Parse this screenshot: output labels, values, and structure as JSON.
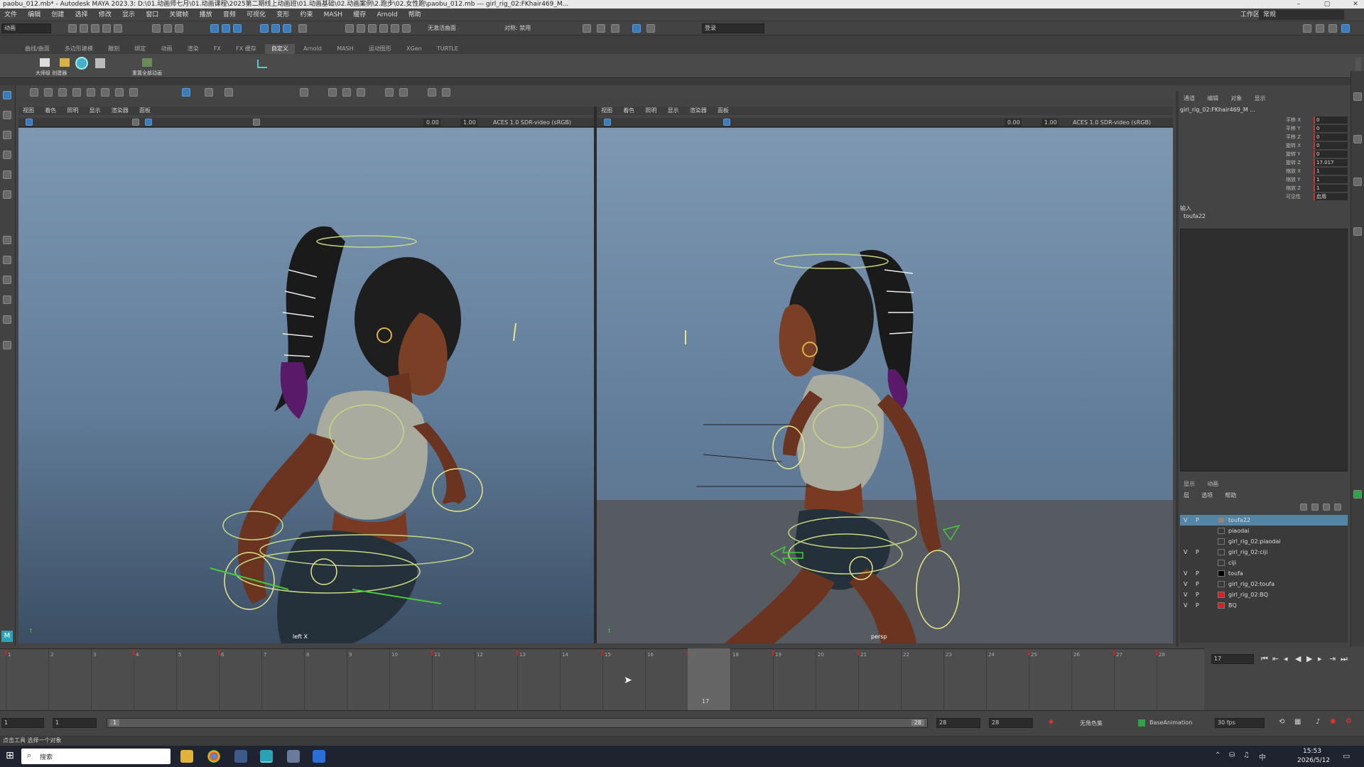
{
  "titlebar": {
    "text": "paobu_012.mb* - Autodesk MAYA 2023.3: D:\\01.动画师七月\\01.动画课程\\2025第二期线上动画班\\01.动画基础\\02.动画案例\\2.跑步\\02.女性跑\\paobu_012.mb  ---  girl_rig_02:FKhair469_M...",
    "workspace_label": "工作区:",
    "workspace_value": "常规"
  },
  "menubar": [
    "文件",
    "编辑",
    "创建",
    "选择",
    "修改",
    "显示",
    "窗口",
    "关键帧",
    "播放",
    "音频",
    "可视化",
    "变形",
    "约束",
    "MASH",
    "缓存",
    "Arnold",
    "帮助"
  ],
  "statusline": {
    "mode": "动画",
    "no_live_surface": "无激活曲面",
    "symmetry": "对称: 禁用",
    "login": "登录"
  },
  "shelf_tabs": [
    "曲线/曲面",
    "多边形建模",
    "雕刻",
    "绑定",
    "动画",
    "渲染",
    "FX",
    "FX 缓存",
    "自定义",
    "Arnold",
    "MASH",
    "运动图形",
    "XGen",
    "TURTLE"
  ],
  "shelf_active": "自定义",
  "shelf_items": [
    "大师级 创建器",
    "重置全部动画"
  ],
  "viewport_menu": [
    "视图",
    "着色",
    "照明",
    "显示",
    "渲染器",
    "面板"
  ],
  "viewports": [
    {
      "name": "left X",
      "exposure": "0.00",
      "gamma": "1.00",
      "colorspace": "ACES 1.0 SDR-video (sRGB)"
    },
    {
      "name": "persp",
      "exposure": "0.00",
      "gamma": "1.00",
      "colorspace": "ACES 1.0 SDR-video (sRGB)"
    }
  ],
  "channel_box": {
    "tabs": [
      "通道",
      "编辑",
      "对象",
      "显示"
    ],
    "object": "girl_rig_02:FKhair469_M ...",
    "channels": [
      {
        "label": "平移 X",
        "value": "0"
      },
      {
        "label": "平移 Y",
        "value": "0"
      },
      {
        "label": "平移 Z",
        "value": "0"
      },
      {
        "label": "旋转 X",
        "value": "0"
      },
      {
        "label": "旋转 Y",
        "value": "0"
      },
      {
        "label": "旋转 Z",
        "value": "17.017"
      },
      {
        "label": "缩放 X",
        "value": "1"
      },
      {
        "label": "缩放 Y",
        "value": "1"
      },
      {
        "label": "缩放 Z",
        "value": "1"
      },
      {
        "label": "可见性",
        "value": "启用"
      }
    ],
    "inputs_label": "输入",
    "inputs_item": "toufa22"
  },
  "layer_editor": {
    "tabs": [
      "显示",
      "动画"
    ],
    "menu": [
      "层",
      "选项",
      "帮助"
    ],
    "layers": [
      {
        "v": "V",
        "p": "P",
        "name": "toufa22",
        "color": "#888888",
        "selected": true
      },
      {
        "v": "",
        "p": "",
        "name": "piaodai",
        "color": "",
        "selected": false
      },
      {
        "v": "",
        "p": "",
        "name": "girl_rig_02:piaodai",
        "color": "",
        "selected": false
      },
      {
        "v": "V",
        "p": "P",
        "name": "girl_rig_02:ciji",
        "color": "",
        "selected": false
      },
      {
        "v": "",
        "p": "",
        "name": "ciji",
        "color": "",
        "selected": false
      },
      {
        "v": "V",
        "p": "P",
        "name": "toufa",
        "color": "#000000",
        "selected": false
      },
      {
        "v": "V",
        "p": "P",
        "name": "girl_rig_02:toufa",
        "color": "",
        "selected": false
      },
      {
        "v": "V",
        "p": "P",
        "name": "girl_rig_02:BQ",
        "color": "#d81e1e",
        "selected": false
      },
      {
        "v": "V",
        "p": "P",
        "name": "BQ",
        "color": "#d81e1e",
        "selected": false
      }
    ]
  },
  "timeline": {
    "frames": [
      1,
      2,
      3,
      4,
      5,
      6,
      7,
      8,
      9,
      10,
      11,
      12,
      13,
      14,
      15,
      16,
      17,
      18,
      19,
      20,
      21,
      22,
      23,
      24,
      25,
      26,
      27,
      28
    ],
    "current_frame": "17",
    "keys": [
      1,
      4,
      6,
      11,
      13,
      15,
      17,
      19,
      21,
      25,
      27,
      28
    ]
  },
  "playback": {
    "current": "17"
  },
  "range": {
    "start": "1",
    "inner_start": "1",
    "bar_start": "1",
    "bar_end": "28",
    "inner_end": "28",
    "end": "28",
    "character_set": "无角色集",
    "anim_layer": "BaseAnimation",
    "fps": "30 fps"
  },
  "cmdline": {
    "text": "点击工具 选择一个对象"
  },
  "taskbar": {
    "search": "搜索",
    "time": "15:53",
    "date": "2026/5/12"
  },
  "colors": {
    "accent": "#3a7bb8",
    "keyframe": "#c8242a",
    "selected_layer": "#5285a6"
  }
}
